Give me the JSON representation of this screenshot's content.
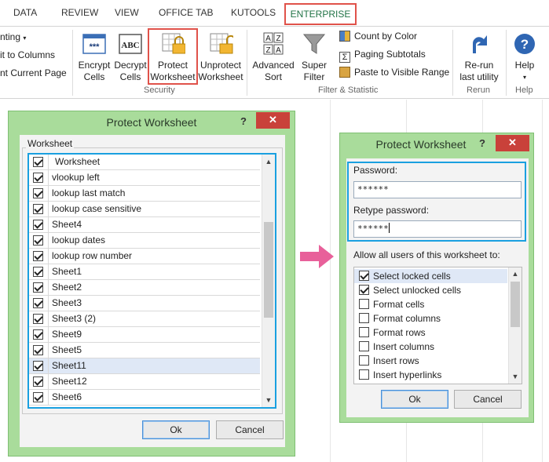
{
  "tabs": {
    "data": "DATA",
    "review": "REVIEW",
    "view": "VIEW",
    "office_tab": "OFFICE TAB",
    "kutools": "KUTOOLS",
    "enterprise": "ENTERPRISE"
  },
  "ribbon": {
    "left_items": [
      "nting",
      "it to Columns",
      "nt Current Page"
    ],
    "encrypt_cells": [
      "Encrypt",
      "Cells"
    ],
    "decrypt_cells": [
      "Decrypt",
      "Cells"
    ],
    "protect_worksheet": [
      "Protect",
      "Worksheet"
    ],
    "unprotect_worksheet": [
      "Unprotect",
      "Worksheet"
    ],
    "security_group": "Security",
    "advanced_sort": [
      "Advanced",
      "Sort"
    ],
    "super_filter": [
      "Super",
      "Filter"
    ],
    "count_by_color": "Count by Color",
    "paging_subtotals": "Paging Subtotals",
    "paste_to_visible": "Paste to Visible Range",
    "filter_group": "Filter & Statistic",
    "rerun": [
      "Re-run",
      "last utility"
    ],
    "rerun_group": "Rerun",
    "help_btn": "Help",
    "help_group": "Help",
    "encrypt_icon_text": "***",
    "decrypt_icon_text": "ABC"
  },
  "dialog1": {
    "title": "Protect Worksheet",
    "help": "?",
    "close": "✕",
    "group_label": "Worksheet",
    "sheets": [
      {
        "name": "Worksheet",
        "checked": true
      },
      {
        "name": "vlookup left",
        "checked": true
      },
      {
        "name": "lookup last match",
        "checked": true
      },
      {
        "name": "lookup case sensitive",
        "checked": true
      },
      {
        "name": "Sheet4",
        "checked": true
      },
      {
        "name": "lookup dates",
        "checked": true
      },
      {
        "name": "lookup row number",
        "checked": true
      },
      {
        "name": "Sheet1",
        "checked": true
      },
      {
        "name": "Sheet2",
        "checked": true
      },
      {
        "name": "Sheet3",
        "checked": true
      },
      {
        "name": "Sheet3 (2)",
        "checked": true
      },
      {
        "name": "Sheet9",
        "checked": true
      },
      {
        "name": "Sheet5",
        "checked": true
      },
      {
        "name": "Sheet11",
        "checked": true
      },
      {
        "name": "Sheet12",
        "checked": true
      },
      {
        "name": "Sheet6",
        "checked": true
      }
    ],
    "ok": "Ok",
    "cancel": "Cancel"
  },
  "dialog2": {
    "title": "Protect Worksheet",
    "help": "?",
    "close": "✕",
    "password_label": "Password:",
    "password_value": "******",
    "retype_label": "Retype password:",
    "retype_value": "******",
    "allow_label": "Allow all users of this worksheet to:",
    "permissions": [
      {
        "name": "Select locked cells",
        "checked": true
      },
      {
        "name": "Select unlocked cells",
        "checked": true
      },
      {
        "name": "Format cells",
        "checked": false
      },
      {
        "name": "Format columns",
        "checked": false
      },
      {
        "name": "Format rows",
        "checked": false
      },
      {
        "name": "Insert columns",
        "checked": false
      },
      {
        "name": "Insert rows",
        "checked": false
      },
      {
        "name": "Insert hyperlinks",
        "checked": false
      }
    ],
    "ok": "Ok",
    "cancel": "Cancel"
  },
  "colors": {
    "dialog_bg": "#a9dc9b",
    "highlight_red": "#e0524a",
    "highlight_blue": "#1aa0e0",
    "arrow_pink": "#e8609a",
    "close_red": "#c9413a"
  }
}
